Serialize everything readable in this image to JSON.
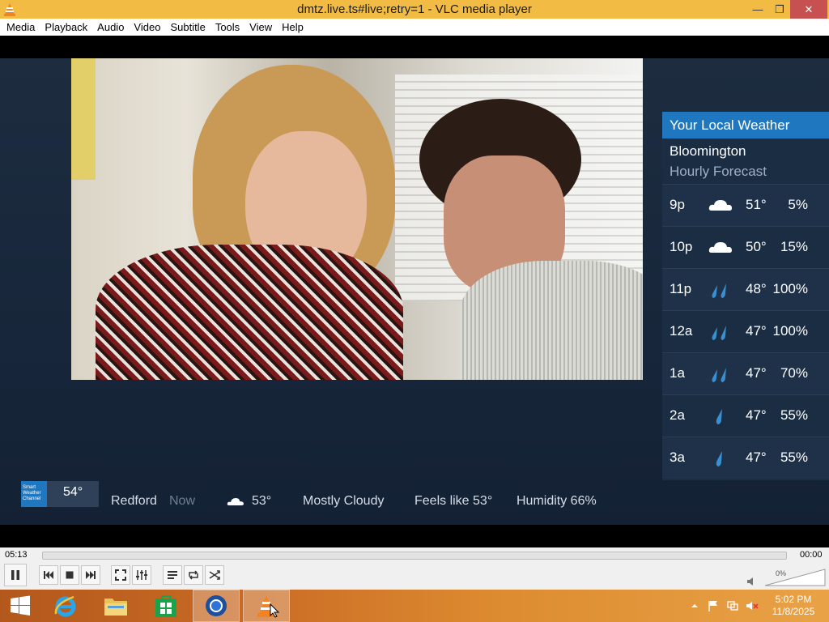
{
  "window": {
    "title": "dmtz.live.ts#live;retry=1 - VLC media player",
    "min_glyph": "—",
    "max_glyph": "❐",
    "close_glyph": "✕"
  },
  "menu": [
    "Media",
    "Playback",
    "Audio",
    "Video",
    "Subtitle",
    "Tools",
    "View",
    "Help"
  ],
  "weather_panel": {
    "header": "Your Local Weather",
    "city": "Bloomington",
    "subtitle": "Hourly Forecast",
    "rows": [
      {
        "hour": "9p",
        "icon": "cloud-icon",
        "temp": "51°",
        "precip": "5%"
      },
      {
        "hour": "10p",
        "icon": "cloud-icon",
        "temp": "50°",
        "precip": "15%"
      },
      {
        "hour": "11p",
        "icon": "rain-heavy-icon",
        "temp": "48°",
        "precip": "100%"
      },
      {
        "hour": "12a",
        "icon": "rain-heavy-icon",
        "temp": "47°",
        "precip": "100%"
      },
      {
        "hour": "1a",
        "icon": "rain-heavy-icon",
        "temp": "47°",
        "precip": "70%"
      },
      {
        "hour": "2a",
        "icon": "rain-drop-icon",
        "temp": "47°",
        "precip": "55%"
      },
      {
        "hour": "3a",
        "icon": "rain-drop-icon",
        "temp": "47°",
        "precip": "55%"
      }
    ]
  },
  "ticker": {
    "logo_text": "Smart Weather Channel",
    "current_temp": "54°",
    "location": "Redford",
    "now": "Now",
    "temp": "53°",
    "condition": "Mostly Cloudy",
    "feels_like": "Feels like 53°",
    "humidity": "Humidity 66%"
  },
  "player": {
    "elapsed": "05:13",
    "remaining": "00:00",
    "volume": "0%",
    "progress": 0
  },
  "taskbar": {
    "clock_time": "5:02 PM",
    "clock_date": "11/8/2025",
    "apps": [
      "windows-start",
      "internet-explorer",
      "file-explorer",
      "store",
      "chrome",
      "vlc"
    ]
  },
  "colors": {
    "title_bar": "#f2bc44",
    "weather_header": "#1f78bf",
    "close_button": "#c75050"
  }
}
